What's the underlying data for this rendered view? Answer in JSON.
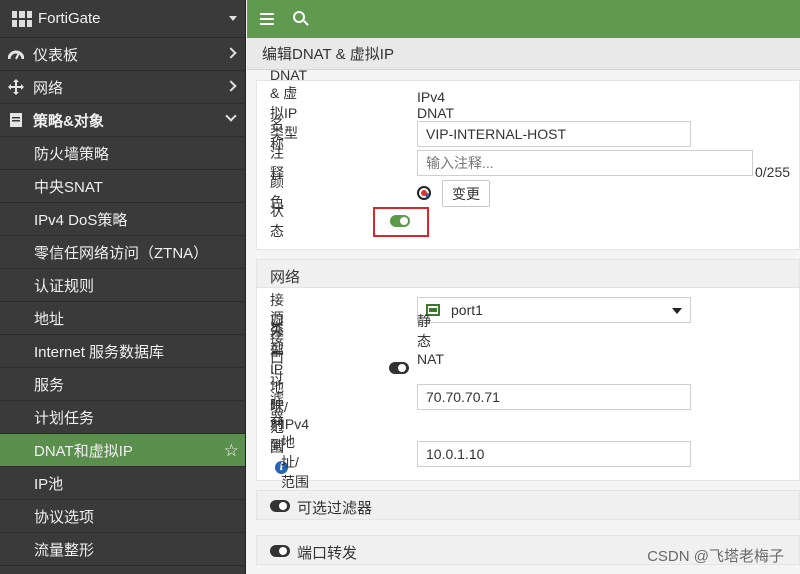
{
  "brand": {
    "name": "FortiGate"
  },
  "sidebar": {
    "items": [
      {
        "label": "仪表板",
        "level": "top",
        "icon": "dashboard-icon",
        "chevron": "right"
      },
      {
        "label": "网络",
        "level": "top",
        "icon": "network-icon",
        "chevron": "right"
      },
      {
        "label": "策略&对象",
        "level": "top",
        "icon": "policy-objects-icon",
        "chevron": "down",
        "bold": true
      },
      {
        "label": "防火墙策略",
        "level": "sub"
      },
      {
        "label": "中央SNAT",
        "level": "sub"
      },
      {
        "label": "IPv4 DoS策略",
        "level": "sub"
      },
      {
        "label": "零信任网络访问（ZTNA）",
        "level": "sub"
      },
      {
        "label": "认证规则",
        "level": "sub"
      },
      {
        "label": "地址",
        "level": "sub"
      },
      {
        "label": "Internet 服务数据库",
        "level": "sub"
      },
      {
        "label": "服务",
        "level": "sub"
      },
      {
        "label": "计划任务",
        "level": "sub"
      },
      {
        "label": "DNAT和虚拟IP",
        "level": "sub",
        "active": true
      },
      {
        "label": "IP池",
        "level": "sub"
      },
      {
        "label": "协议选项",
        "level": "sub"
      },
      {
        "label": "流量整形",
        "level": "sub"
      }
    ]
  },
  "page": {
    "title": "编辑DNAT & 虚拟IP"
  },
  "form": {
    "type_label": "DNAT & 虚拟IP类型",
    "type_value": "IPv4 DNAT",
    "name_label": "名称",
    "name_value": "VIP-INTERNAL-HOST",
    "comment_label": "注释",
    "comment_placeholder": "输入注释...",
    "comment_counter": "0/255",
    "color_label": "颜色",
    "color_button": "变更",
    "status_label": "状态",
    "status_enabled": true
  },
  "network": {
    "section_title": "网络",
    "interface_label": "接口",
    "interface_value": "port1",
    "type_label": "类型",
    "type_value": "静态NAT",
    "source_filter_label": "源接口过滤器",
    "source_filter_enabled": false,
    "external_ip_label": "外部IP地址/范围",
    "external_ip_value": "70.70.70.71",
    "mapped_label": "映射到",
    "ipv4_label": "IPv4地址/范围",
    "ipv4_value": "10.0.1.10"
  },
  "optional_filter": {
    "label": "可选过滤器",
    "enabled": false
  },
  "port_forward": {
    "label": "端口转发",
    "enabled": false
  },
  "watermark": "CSDN @飞塔老梅子",
  "colors": {
    "accent": "#5f9a4e",
    "sidebar_bg": "#3a3a3a",
    "active_item": "#5b8f4e",
    "highlight_box": "#d9262b"
  }
}
